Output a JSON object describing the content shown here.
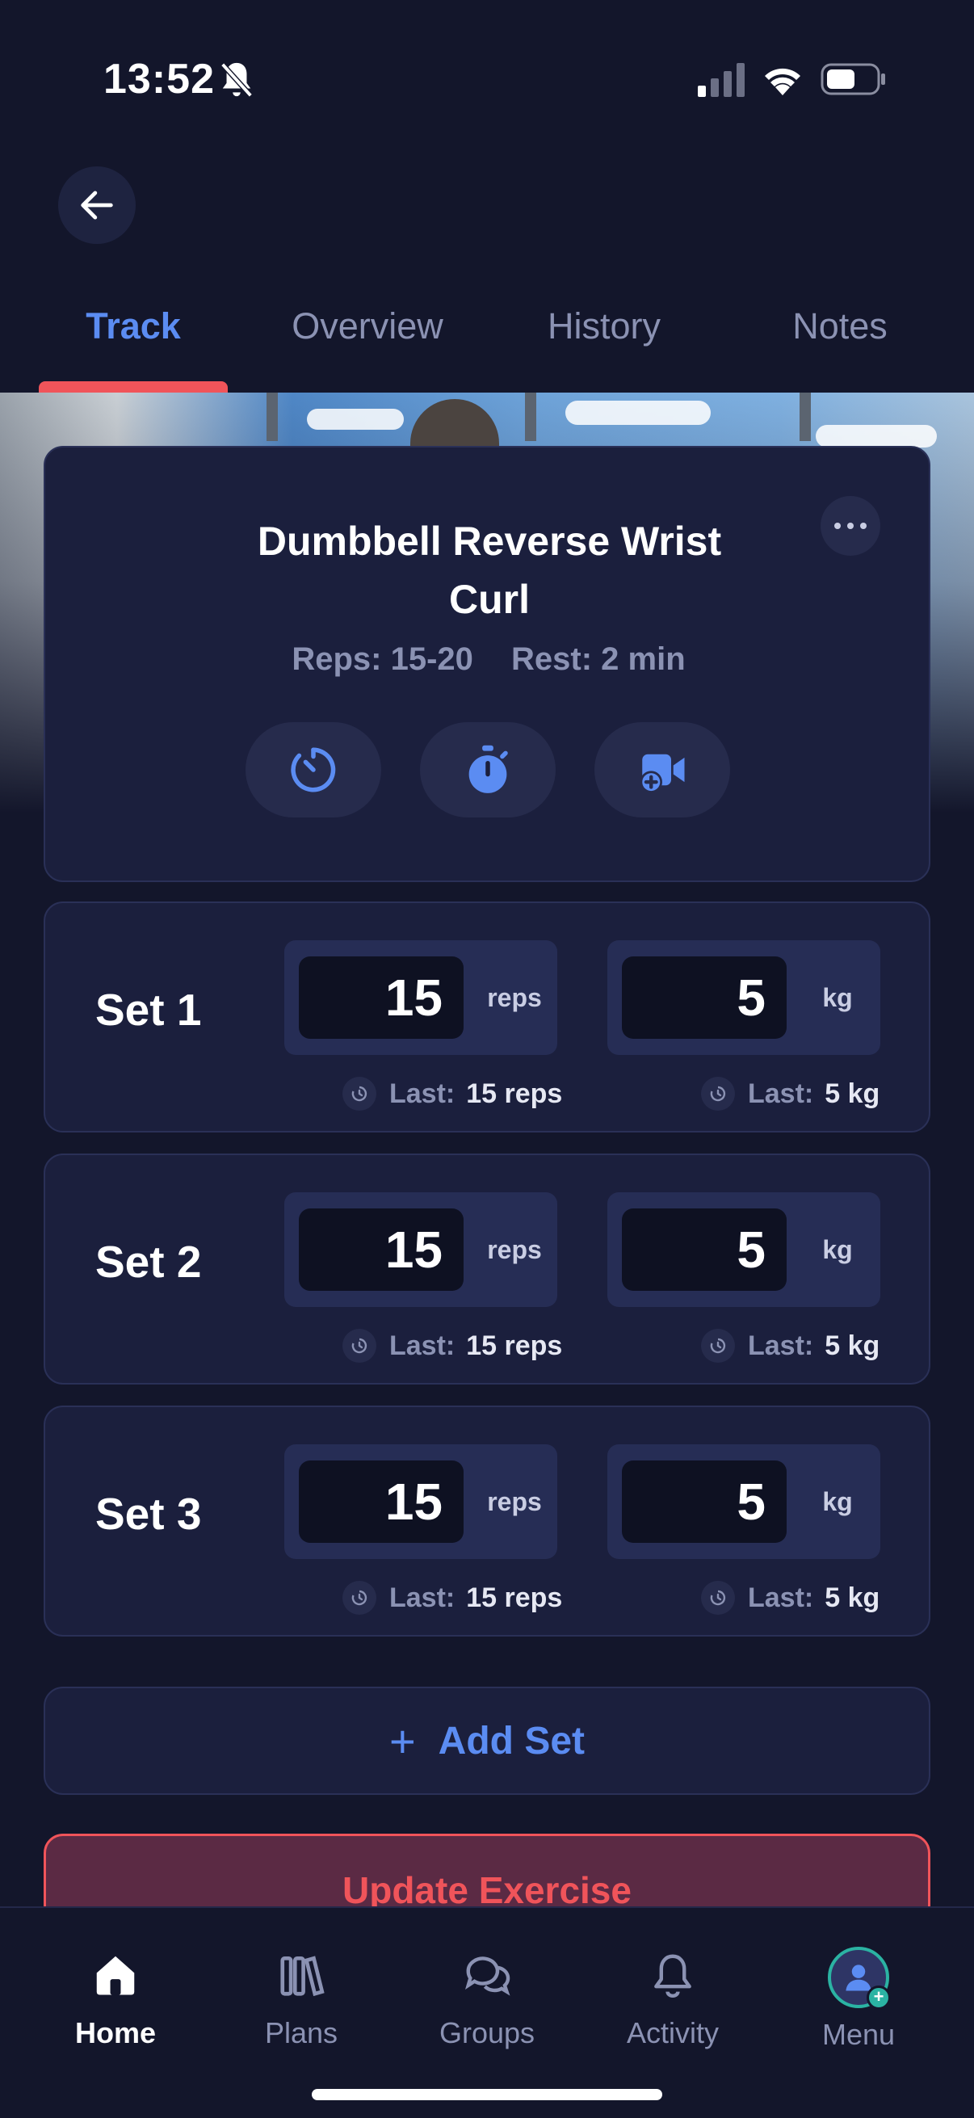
{
  "status_bar": {
    "time": "13:52"
  },
  "tabs": [
    {
      "label": "Track",
      "active": true
    },
    {
      "label": "Overview",
      "active": false
    },
    {
      "label": "History",
      "active": false
    },
    {
      "label": "Notes",
      "active": false
    }
  ],
  "exercise": {
    "title_line1": "Dumbbell Reverse Wrist",
    "title_line2": "Curl",
    "reps": "Reps: 15-20",
    "rest": "Rest: 2 min"
  },
  "sets": [
    {
      "label": "Set 1",
      "reps": "15",
      "reps_unit": "reps",
      "weight": "5",
      "weight_unit": "kg",
      "last_label": "Last:",
      "last_reps": "15 reps",
      "last_weight": "5 kg"
    },
    {
      "label": "Set 2",
      "reps": "15",
      "reps_unit": "reps",
      "weight": "5",
      "weight_unit": "kg",
      "last_label": "Last:",
      "last_reps": "15 reps",
      "last_weight": "5 kg"
    },
    {
      "label": "Set 3",
      "reps": "15",
      "reps_unit": "reps",
      "weight": "5",
      "weight_unit": "kg",
      "last_label": "Last:",
      "last_reps": "15 reps",
      "last_weight": "5 kg"
    }
  ],
  "add_set_label": "Add Set",
  "update_label": "Update Exercise",
  "bottom_nav": [
    {
      "label": "Home",
      "active": true
    },
    {
      "label": "Plans",
      "active": false
    },
    {
      "label": "Groups",
      "active": false
    },
    {
      "label": "Activity",
      "active": false
    },
    {
      "label": "Menu",
      "active": false
    }
  ],
  "colors": {
    "accent": "#5b8cf2",
    "danger": "#f0545a",
    "background": "#13162b",
    "card": "#1b1f3d"
  }
}
